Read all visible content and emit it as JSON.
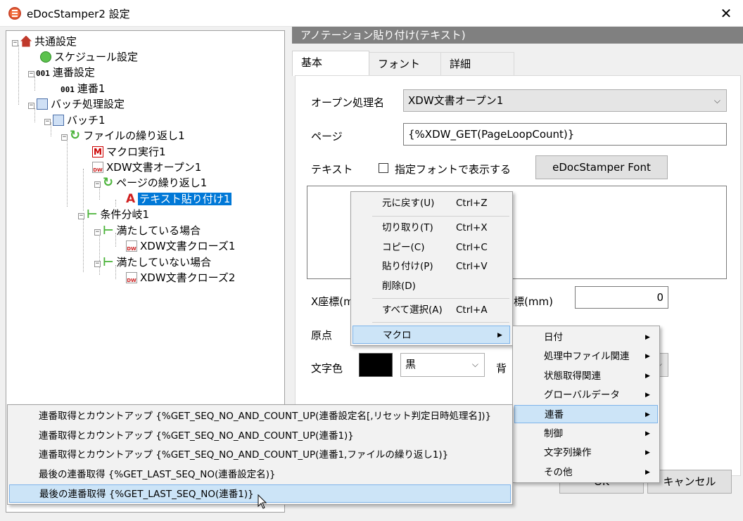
{
  "window": {
    "title": "eDocStamper2 設定",
    "close_glyph": "✕"
  },
  "tree": {
    "items": [
      {
        "label": "共通設定"
      },
      {
        "label": "スケジュール設定"
      },
      {
        "prefix": "001",
        "label": "連番設定"
      },
      {
        "prefix": "001",
        "label": "連番1"
      },
      {
        "label": "バッチ処理設定"
      },
      {
        "label": "バッチ1"
      },
      {
        "label": "ファイルの繰り返し1"
      },
      {
        "label": "マクロ実行1"
      },
      {
        "label": "XDW文書オープン1"
      },
      {
        "label": "ページの繰り返し1"
      },
      {
        "label": "テキスト貼り付け1"
      },
      {
        "label": "条件分岐1"
      },
      {
        "label": "満たしている場合"
      },
      {
        "label": "XDW文書クローズ1"
      },
      {
        "label": "満たしていない場合"
      },
      {
        "label": "XDW文書クローズ2"
      }
    ]
  },
  "panel": {
    "header": "アノテーション貼り付け(テキスト)",
    "tabs": [
      {
        "label": "基本"
      },
      {
        "label": "フォント"
      },
      {
        "label": "詳細"
      }
    ],
    "open_process_label": "オープン処理名",
    "open_process_value": "XDW文書オープン1",
    "page_label": "ページ",
    "page_value": "{%XDW_GET(PageLoopCount)}",
    "text_label": "テキスト",
    "font_checkbox_label": "指定フォントで表示する",
    "font_button": "eDocStamper Font",
    "x_label": "X座標(m",
    "y_label": "標(mm)",
    "y_value": "0",
    "origin_label": "原点",
    "color_label": "文字色",
    "color_value": "黒",
    "bg_label": "背",
    "ok_button": "OK",
    "cancel_button": "キャンセル"
  },
  "context_menu": {
    "items": [
      {
        "label": "元に戻す(U)",
        "shortcut": "Ctrl+Z"
      },
      {
        "label": "切り取り(T)",
        "shortcut": "Ctrl+X"
      },
      {
        "label": "コピー(C)",
        "shortcut": "Ctrl+C"
      },
      {
        "label": "貼り付け(P)",
        "shortcut": "Ctrl+V"
      },
      {
        "label": "削除(D)",
        "shortcut": ""
      },
      {
        "label": "すべて選択(A)",
        "shortcut": "Ctrl+A"
      },
      {
        "label": "マクロ",
        "shortcut": ""
      }
    ]
  },
  "macro_menu": {
    "items": [
      {
        "label": "日付"
      },
      {
        "label": "処理中ファイル関連"
      },
      {
        "label": "状態取得関連"
      },
      {
        "label": "グローバルデータ"
      },
      {
        "label": "連番"
      },
      {
        "label": "制御"
      },
      {
        "label": "文字列操作"
      },
      {
        "label": "その他"
      }
    ]
  },
  "seq_menu": {
    "items": [
      {
        "label": "連番取得とカウントアップ {%GET_SEQ_NO_AND_COUNT_UP(連番設定名[,リセット判定日時処理名])}"
      },
      {
        "label": "連番取得とカウントアップ {%GET_SEQ_NO_AND_COUNT_UP(連番1)}"
      },
      {
        "label": "連番取得とカウントアップ {%GET_SEQ_NO_AND_COUNT_UP(連番1,ファイルの繰り返し1)}"
      },
      {
        "label": "最後の連番取得 {%GET_LAST_SEQ_NO(連番設定名)}"
      },
      {
        "label": "最後の連番取得 {%GET_LAST_SEQ_NO(連番1)}"
      }
    ]
  },
  "colors": {
    "accent": "#0078d7",
    "menu_highlight": "#cce4f7",
    "header": "#808080"
  }
}
